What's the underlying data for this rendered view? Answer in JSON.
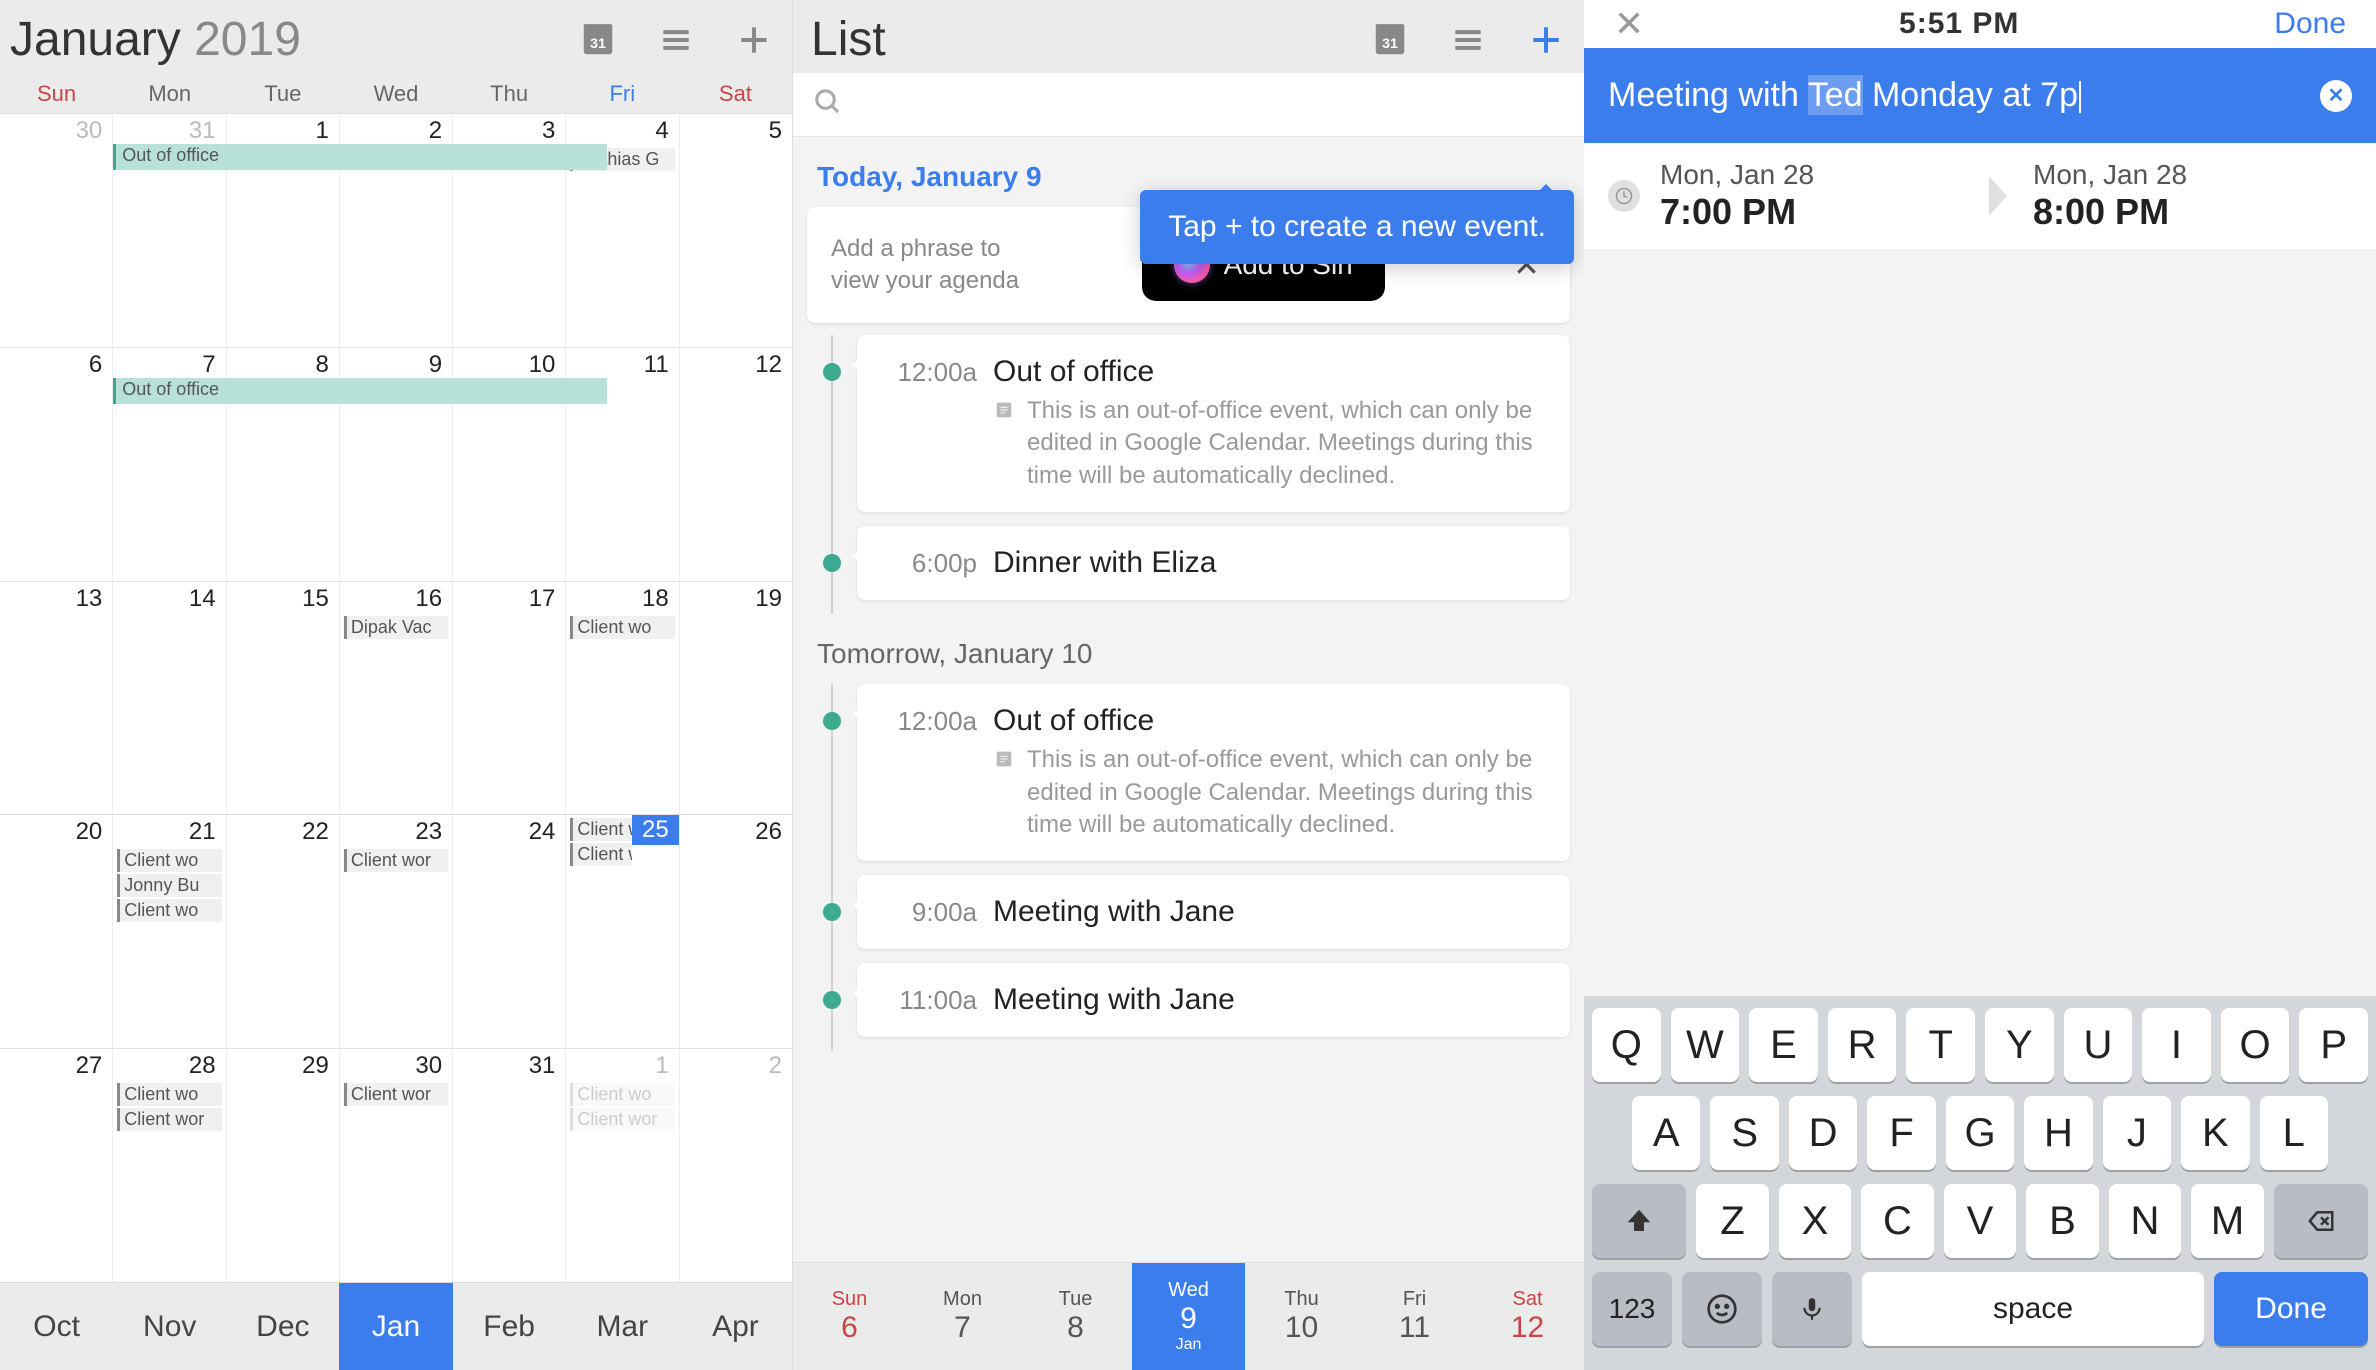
{
  "panel1": {
    "month": "January",
    "year": "2019",
    "dow": [
      "Sun",
      "Mon",
      "Tue",
      "Wed",
      "Thu",
      "Fri",
      "Sat"
    ],
    "months_strip": [
      "Oct",
      "Nov",
      "Dec",
      "Jan",
      "Feb",
      "Mar",
      "Apr"
    ],
    "current_month_idx": 3,
    "weeks": [
      [
        {
          "n": "30",
          "other": true
        },
        {
          "n": "31",
          "other": true,
          "ooo_span": "Out of office"
        },
        {
          "n": "1"
        },
        {
          "n": "2"
        },
        {
          "n": "3"
        },
        {
          "n": "4",
          "ev": [
            "Mathias G"
          ]
        },
        {
          "n": "5"
        }
      ],
      [
        {
          "n": "6"
        },
        {
          "n": "7",
          "ooo_span": "Out of office"
        },
        {
          "n": "8"
        },
        {
          "n": "9"
        },
        {
          "n": "10"
        },
        {
          "n": "11"
        },
        {
          "n": "12"
        }
      ],
      [
        {
          "n": "13"
        },
        {
          "n": "14"
        },
        {
          "n": "15"
        },
        {
          "n": "16",
          "ev": [
            "Dipak Vac"
          ]
        },
        {
          "n": "17"
        },
        {
          "n": "18",
          "ev": [
            "Client wo"
          ]
        },
        {
          "n": "19"
        }
      ],
      [
        {
          "n": "20"
        },
        {
          "n": "21",
          "ev": [
            "Client wo",
            "Jonny Bu",
            "Client wo"
          ]
        },
        {
          "n": "22"
        },
        {
          "n": "23",
          "ev": [
            "Client wor"
          ]
        },
        {
          "n": "24"
        },
        {
          "n": "25",
          "today": true,
          "ev": [
            "Client wo",
            "Client wor"
          ]
        },
        {
          "n": "26"
        }
      ],
      [
        {
          "n": "27"
        },
        {
          "n": "28",
          "ev": [
            "Client wo",
            "Client wor"
          ]
        },
        {
          "n": "29"
        },
        {
          "n": "30",
          "ev": [
            "Client wor"
          ]
        },
        {
          "n": "31"
        },
        {
          "n": "1",
          "other": true,
          "fev": [
            "Client wo",
            "Client wor"
          ]
        },
        {
          "n": "2",
          "other": true
        }
      ]
    ]
  },
  "panel2": {
    "title": "List",
    "tooltip": "Tap + to create a new event.",
    "today_label": "Today, January 9",
    "siri_prompt": "Add a phrase to view your agenda",
    "siri_btn": "Add to Siri",
    "tomorrow_label": "Tomorrow, January 10",
    "ooo_desc": "This is an out-of-office event, which can only be edited in Google Calendar. Meetings during this time will be automatically declined.",
    "today_events": [
      {
        "time": "12:00a",
        "title": "Out of office",
        "desc": true
      },
      {
        "time": "6:00p",
        "title": "Dinner with Eliza"
      }
    ],
    "tomorrow_events": [
      {
        "time": "12:00a",
        "title": "Out of office",
        "desc": true
      },
      {
        "time": "9:00a",
        "title": "Meeting with Jane"
      },
      {
        "time": "11:00a",
        "title": "Meeting with Jane"
      }
    ],
    "days_strip": [
      {
        "dow": "Sun",
        "n": "6",
        "wknd": true
      },
      {
        "dow": "Mon",
        "n": "7"
      },
      {
        "dow": "Tue",
        "n": "8"
      },
      {
        "dow": "Wed",
        "n": "9",
        "cur": true,
        "mo": "Jan"
      },
      {
        "dow": "Thu",
        "n": "10"
      },
      {
        "dow": "Fri",
        "n": "11"
      },
      {
        "dow": "Sat",
        "n": "12",
        "wknd": true
      }
    ]
  },
  "panel3": {
    "status_time": "5:51 PM",
    "done": "Done",
    "input_pre": "Meeting with ",
    "input_sel": "Ted",
    "input_post": " Monday at 7p",
    "start_date": "Mon, Jan 28",
    "start_time": "7:00 PM",
    "end_date": "Mon, Jan 28",
    "end_time": "8:00 PM",
    "kb": {
      "r1": [
        "Q",
        "W",
        "E",
        "R",
        "T",
        "Y",
        "U",
        "I",
        "O",
        "P"
      ],
      "r2": [
        "A",
        "S",
        "D",
        "F",
        "G",
        "H",
        "J",
        "K",
        "L"
      ],
      "r3": [
        "Z",
        "X",
        "C",
        "V",
        "B",
        "N",
        "M"
      ],
      "num": "123",
      "space": "space",
      "done": "Done"
    }
  }
}
